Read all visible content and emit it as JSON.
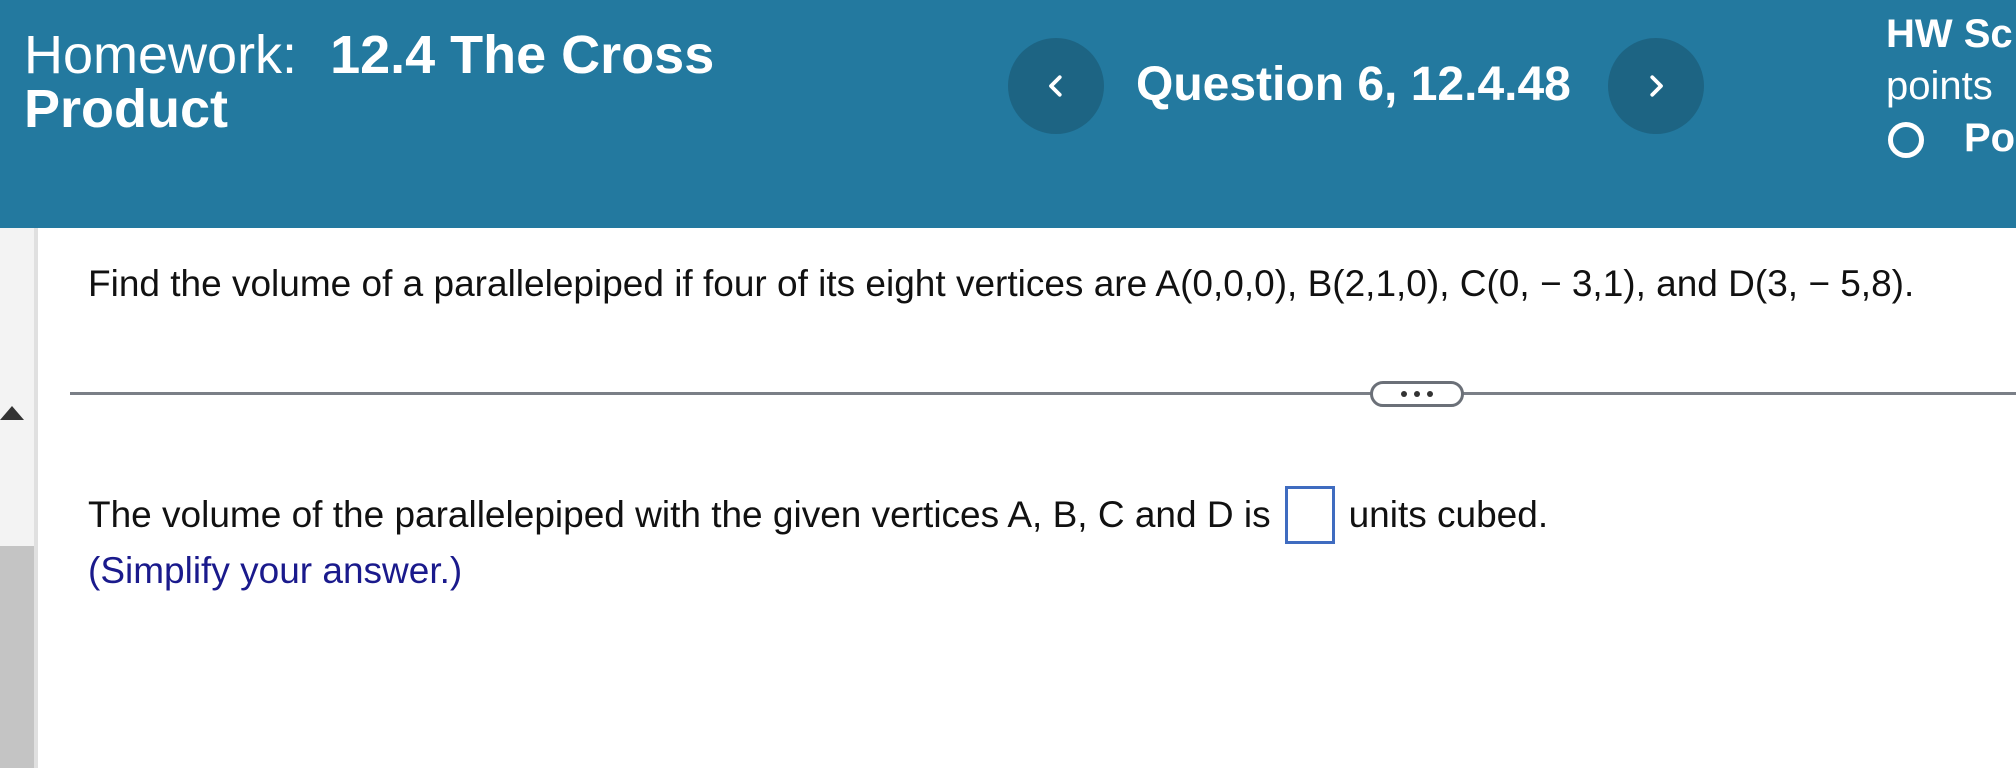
{
  "header": {
    "homework_prefix": "Homework:",
    "homework_name_line1": "12.4 The Cross",
    "homework_name_line2": "Product",
    "prev_label": "<",
    "next_label": ">",
    "question_label": "Question 6, 12.4.48",
    "score_title": "HW Sc",
    "score_points": "points",
    "score_status": "Po",
    "background_color": "#23799f"
  },
  "question": {
    "prompt": "Find the volume of a parallelepiped if four of its eight vertices are A(0,0,0), B(2,1,0), C(0, − 3,1), and D(3, − 5,8).",
    "more_label": "..."
  },
  "answer": {
    "lead_text": "The volume of the parallelepiped with the given vertices A, B, C and D is",
    "trail_text": "units cubed.",
    "input_value": "",
    "hint": "(Simplify your answer.)"
  }
}
